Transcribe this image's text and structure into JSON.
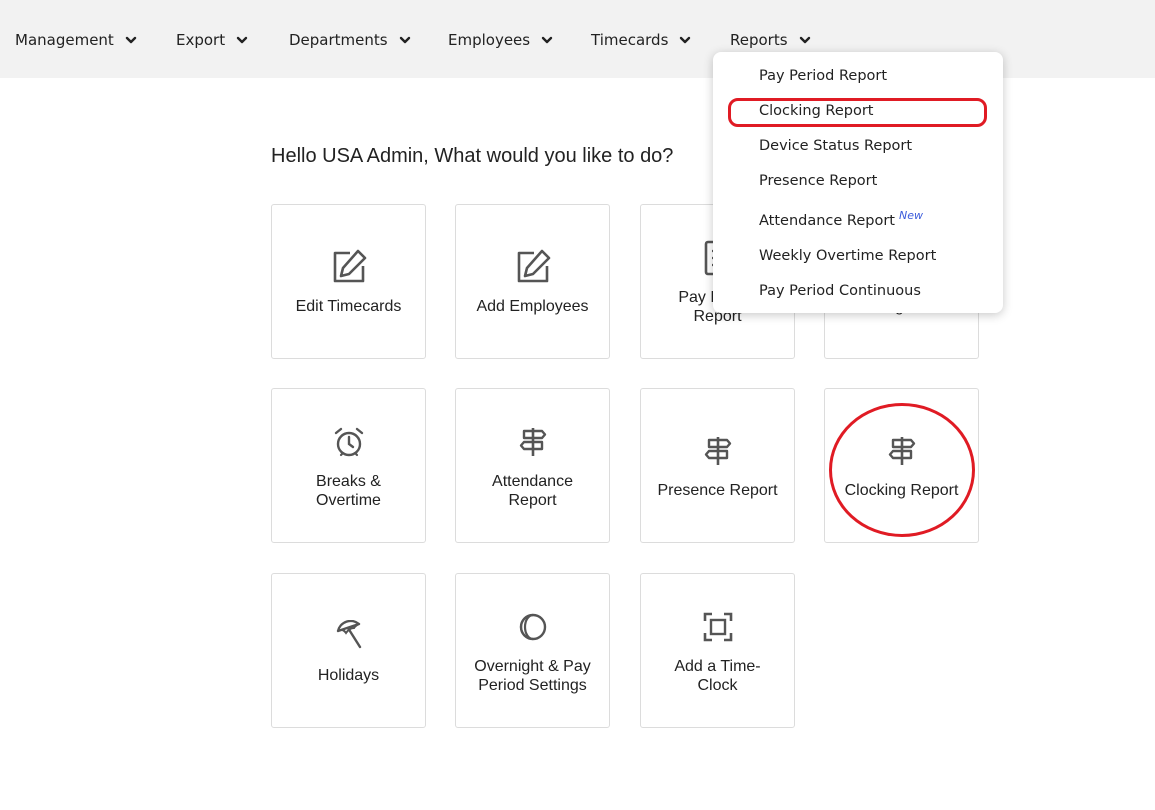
{
  "nav": {
    "items": [
      {
        "label": "Management"
      },
      {
        "label": "Export"
      },
      {
        "label": "Departments"
      },
      {
        "label": "Employees"
      },
      {
        "label": "Timecards"
      },
      {
        "label": "Reports"
      }
    ]
  },
  "greeting": "Hello USA Admin, What would you like to do?",
  "tiles": [
    {
      "label": "Edit Timecards",
      "icon": "edit-icon"
    },
    {
      "label": "Add Employees",
      "icon": "edit-icon"
    },
    {
      "label": "Pay Period Report",
      "icon": "document-icon"
    },
    {
      "label": "management",
      "icon": "settings-icon"
    },
    {
      "label": "Breaks & Overtime",
      "icon": "alarm-clock-icon"
    },
    {
      "label": "Attendance Report",
      "icon": "signpost-icon"
    },
    {
      "label": "Presence Report",
      "icon": "signpost-icon"
    },
    {
      "label": "Clocking Report",
      "icon": "signpost-icon"
    },
    {
      "label": "Holidays",
      "icon": "umbrella-icon"
    },
    {
      "label": "Overnight & Pay Period Settings",
      "icon": "moon-icon"
    },
    {
      "label": "Add a Time-Clock",
      "icon": "focus-frame-icon"
    }
  ],
  "reports_menu": {
    "items": [
      {
        "label": "Pay Period Report"
      },
      {
        "label": "Clocking Report"
      },
      {
        "label": "Device Status Report"
      },
      {
        "label": "Presence Report"
      },
      {
        "label": "Attendance Report",
        "badge": "New"
      },
      {
        "label": "Weekly Overtime Report"
      },
      {
        "label": "Pay Period Continuous"
      }
    ]
  },
  "colors": {
    "nav_bg": "#f2f2f2",
    "annotation": "#e01b24",
    "new_badge": "#3b5bdb",
    "icon_gray": "#555555"
  }
}
